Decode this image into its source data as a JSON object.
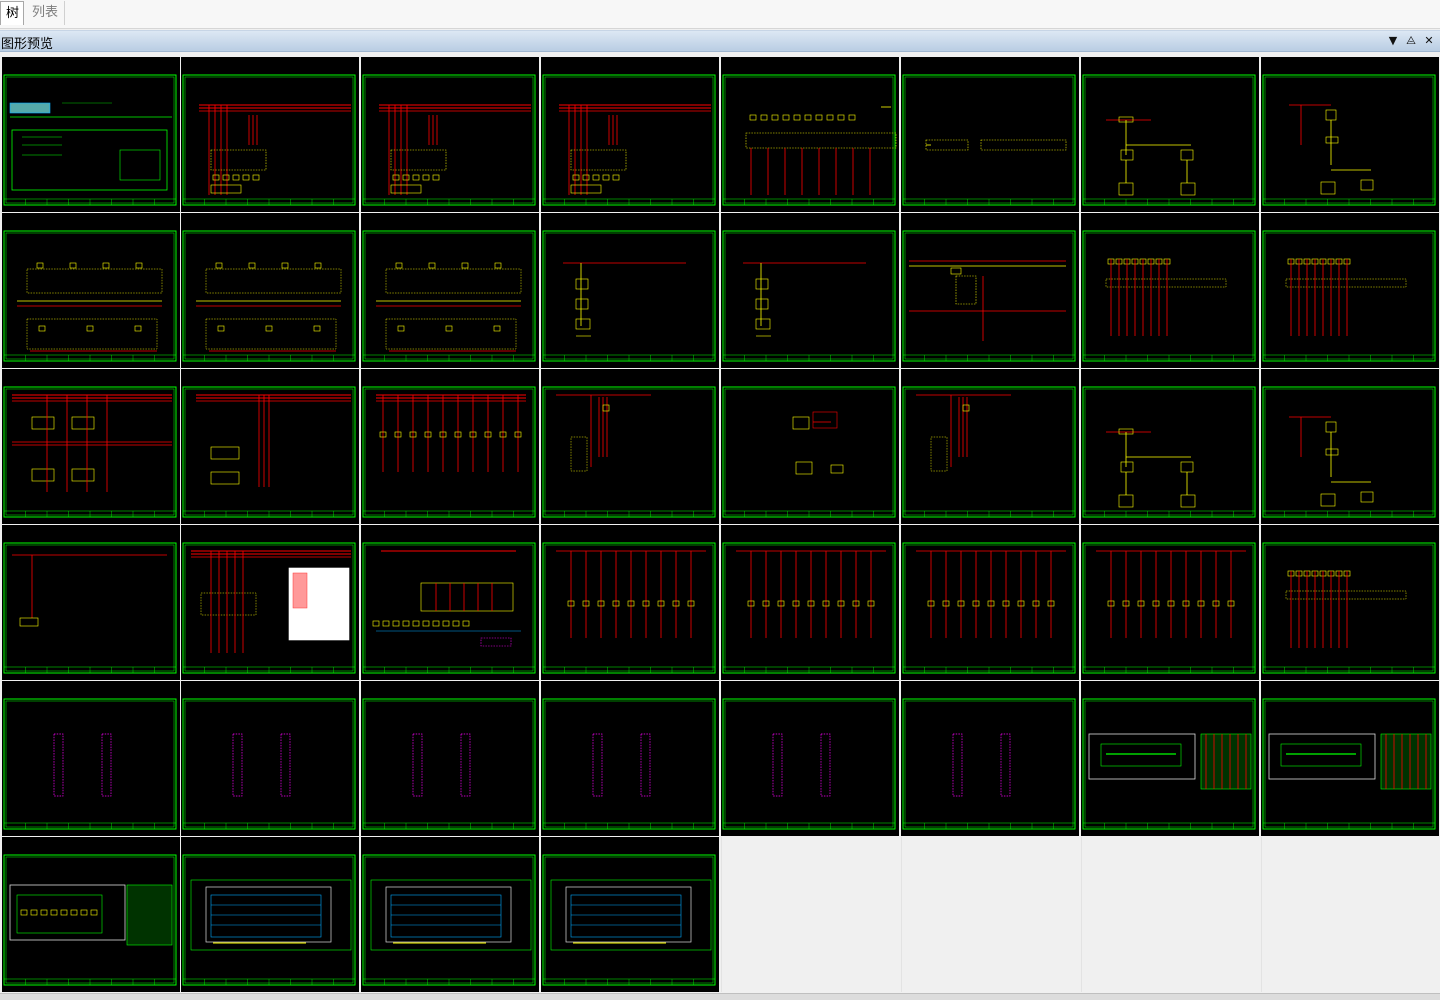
{
  "tabs": [
    {
      "label": "树",
      "active": true
    },
    {
      "label": "列表",
      "active": false
    }
  ],
  "panel": {
    "title": "图形预览",
    "controls": [
      "dropdown-icon",
      "pin-icon",
      "close-icon"
    ]
  },
  "colors": {
    "canvas": "#000000",
    "frame": "#00ff00",
    "wire": "#ff0000",
    "component": "#ffff00",
    "terminal": "#ff00ff",
    "cable": "#00aaff"
  },
  "thumbnails": [
    {
      "index": 1,
      "type": "cover"
    },
    {
      "index": 2,
      "type": "power-bus"
    },
    {
      "index": 3,
      "type": "power-bus"
    },
    {
      "index": 4,
      "type": "power-bus"
    },
    {
      "index": 5,
      "type": "terminal-row"
    },
    {
      "index": 6,
      "type": "terminal-strip"
    },
    {
      "index": 7,
      "type": "control-tree"
    },
    {
      "index": 8,
      "type": "control-branch"
    },
    {
      "index": 9,
      "type": "distribution"
    },
    {
      "index": 10,
      "type": "distribution"
    },
    {
      "index": 11,
      "type": "distribution"
    },
    {
      "index": 12,
      "type": "single-line"
    },
    {
      "index": 13,
      "type": "single-line"
    },
    {
      "index": 14,
      "type": "relay"
    },
    {
      "index": 15,
      "type": "multi-feeder"
    },
    {
      "index": 16,
      "type": "multi-feeder"
    },
    {
      "index": 17,
      "type": "motor-boxes"
    },
    {
      "index": 18,
      "type": "box-pair"
    },
    {
      "index": 19,
      "type": "lamp-row"
    },
    {
      "index": 20,
      "type": "plc-io"
    },
    {
      "index": 21,
      "type": "module"
    },
    {
      "index": 22,
      "type": "plc-io"
    },
    {
      "index": 23,
      "type": "control-tree"
    },
    {
      "index": 24,
      "type": "control-branch"
    },
    {
      "index": 25,
      "type": "single-drop"
    },
    {
      "index": 26,
      "type": "table-sheet"
    },
    {
      "index": 27,
      "type": "plc-rack"
    },
    {
      "index": 28,
      "type": "vertical-lines"
    },
    {
      "index": 29,
      "type": "vertical-lines"
    },
    {
      "index": 30,
      "type": "vertical-lines"
    },
    {
      "index": 31,
      "type": "vertical-lines"
    },
    {
      "index": 32,
      "type": "multi-feeder"
    },
    {
      "index": 33,
      "type": "terminal-pair"
    },
    {
      "index": 34,
      "type": "terminal-pair"
    },
    {
      "index": 35,
      "type": "terminal-pair"
    },
    {
      "index": 36,
      "type": "terminal-pair"
    },
    {
      "index": 37,
      "type": "terminal-pair"
    },
    {
      "index": 38,
      "type": "terminal-pair"
    },
    {
      "index": 39,
      "type": "panel-layout"
    },
    {
      "index": 40,
      "type": "panel-layout"
    },
    {
      "index": 41,
      "type": "cabinet-front"
    },
    {
      "index": 42,
      "type": "cabinet-wiring"
    },
    {
      "index": 43,
      "type": "cabinet-wiring"
    },
    {
      "index": 44,
      "type": "cabinet-wiring"
    }
  ]
}
